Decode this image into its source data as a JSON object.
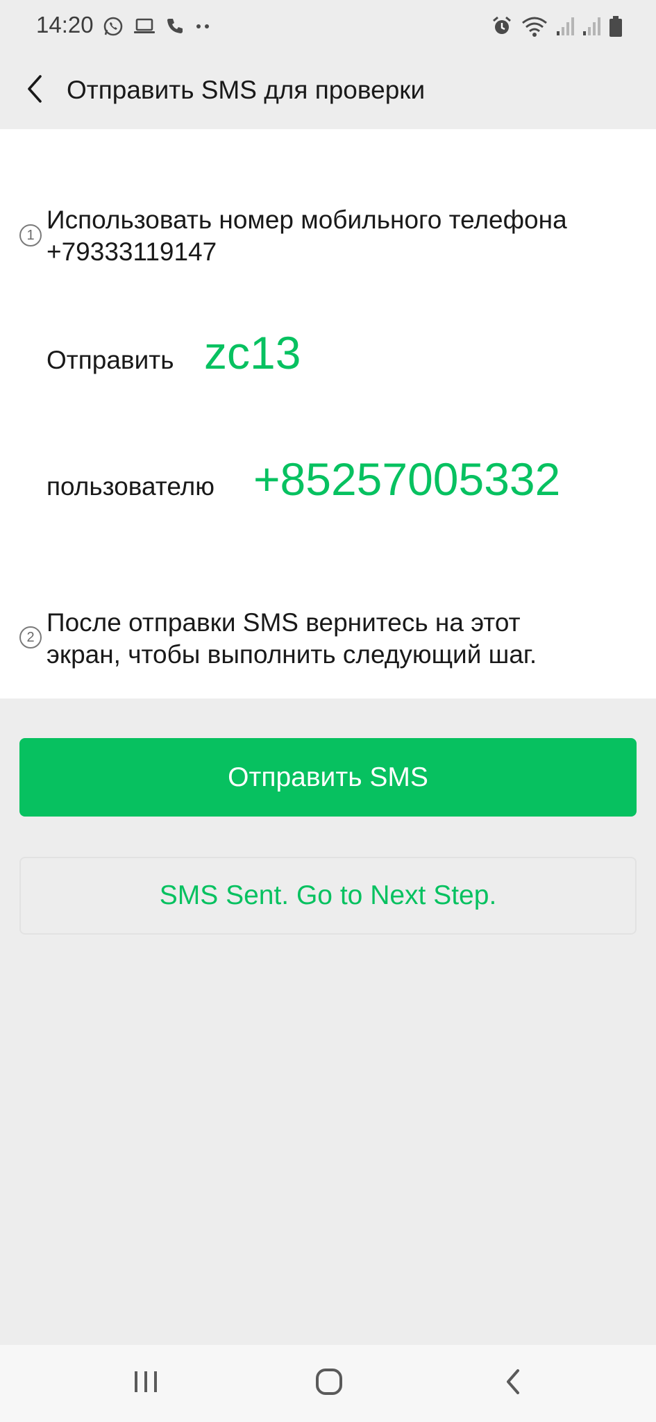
{
  "status_bar": {
    "time": "14:20",
    "left_icons": [
      "whatsapp-icon",
      "laptop-icon",
      "phone-icon",
      "more-dots-icon"
    ],
    "right_icons": [
      "alarm-icon",
      "wifi-icon",
      "signal-icon",
      "signal-icon",
      "battery-icon"
    ]
  },
  "header": {
    "back_icon": "chevron-left-icon",
    "title": "Отправить SMS для проверки"
  },
  "steps": {
    "step1": {
      "number": "1",
      "text_line1": "Использовать номер мобильного телефона",
      "text_line2": "+79333119147"
    },
    "send": {
      "label": "Отправить",
      "value": "zc13"
    },
    "recipient": {
      "label": "пользователю",
      "value": "+85257005332"
    },
    "step2": {
      "number": "2",
      "text_line1": "После отправки SMS вернитесь на этот",
      "text_line2": "экран, чтобы выполнить следующий шаг."
    }
  },
  "buttons": {
    "send_sms": "Отправить SMS",
    "next_step": "SMS Sent. Go to Next Step."
  },
  "nav_bar": {
    "icons": [
      "recent-apps-icon",
      "home-icon",
      "back-icon"
    ]
  },
  "colors": {
    "accent": "#07c160",
    "background": "#ededed",
    "card": "#ffffff"
  }
}
